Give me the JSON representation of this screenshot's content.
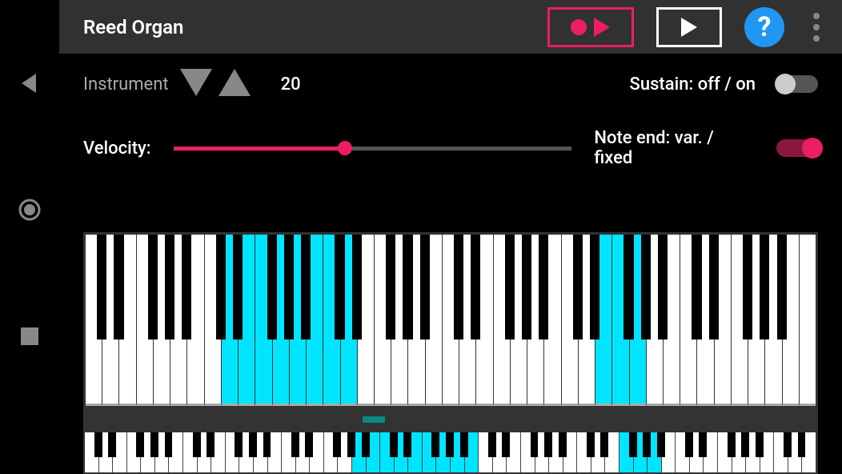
{
  "toolbar": {
    "title": "Reed Organ",
    "help_label": "?"
  },
  "controls": {
    "instrument_label": "Instrument",
    "instrument_value": "20",
    "velocity_label": "Velocity:",
    "velocity_percent": 43,
    "sustain_label": "Sustain: off / on",
    "sustain_on": false,
    "noteend_label": "Note end: var. / fixed",
    "noteend_on": true
  },
  "keyboard": {
    "white_key_count": 43,
    "highlighted_whites": [
      8,
      9,
      10,
      11,
      12,
      13,
      14,
      15,
      30,
      31,
      32
    ],
    "mini_white_count": 52,
    "mini_highlighted": [
      19,
      20,
      21,
      22,
      23,
      24,
      25,
      26,
      27,
      38,
      39,
      40
    ]
  },
  "icons": {
    "back": "back-triangle",
    "record_circle": "record-circle",
    "stop_square": "stop-square"
  }
}
